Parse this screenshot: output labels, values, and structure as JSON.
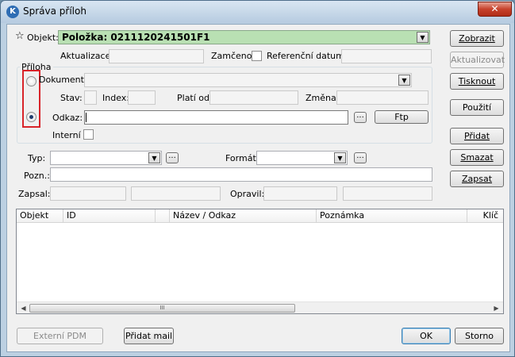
{
  "window": {
    "title": "Správa příloh",
    "close_label": "✕",
    "app_icon_letter": "K"
  },
  "objekt": {
    "label": "Objekt:",
    "value": "Položka: 0211120241501F1",
    "favorite_icon": "star-icon"
  },
  "meta": {
    "aktualizace_label": "Aktualizace:",
    "aktualizace_value": "",
    "zamceno_label": "Zamčeno:",
    "zamceno_checked": false,
    "referencni_datum_label": "Referenční datum:",
    "referencni_datum_value": ""
  },
  "priloha": {
    "group_label": "Příloha",
    "dokument_label": "Dokument:",
    "dokument_value": "",
    "stav_label": "Stav:",
    "stav_value": "",
    "index_label": "Index:",
    "index_value": "",
    "plati_od_label": "Platí od:",
    "plati_od_value": "",
    "zmena_label": "Změna:",
    "zmena_value": "",
    "odkaz_label": "Odkaz:",
    "odkaz_value": "",
    "browse_label": "...",
    "ftp_label": "Ftp",
    "interni_label": "Interní",
    "interni_checked": false,
    "selected_source": "odkaz"
  },
  "details": {
    "typ_label": "Typ:",
    "typ_value": "",
    "typ_browse": "...",
    "format_label": "Formát:",
    "format_value": "",
    "format_browse": "...",
    "pozn_label": "Pozn.:",
    "pozn_value": "",
    "zapsal_label": "Zapsal:",
    "zapsal_value": "",
    "zapsal_value2": "",
    "opravil_label": "Opravil:",
    "opravil_value": "",
    "opravil_value2": ""
  },
  "side_buttons": {
    "zobrazit": "Zobrazit",
    "aktualizovat": "Aktualizovat",
    "tisknout": "Tisknout",
    "pouziti": "Použití",
    "pridat": "Přidat",
    "smazat": "Smazat",
    "zapsat": "Zapsat"
  },
  "table": {
    "columns": [
      "Objekt",
      "ID",
      "",
      "Název / Odkaz",
      "Poznámka",
      "Klíč"
    ],
    "rows": [],
    "scroll_left": "◀",
    "scroll_right": "▶",
    "thumb_grip": "III"
  },
  "footer": {
    "externi_pdm": "Externí PDM",
    "pridat_mail": "Přidat mail",
    "ok": "OK",
    "storno": "Storno"
  }
}
